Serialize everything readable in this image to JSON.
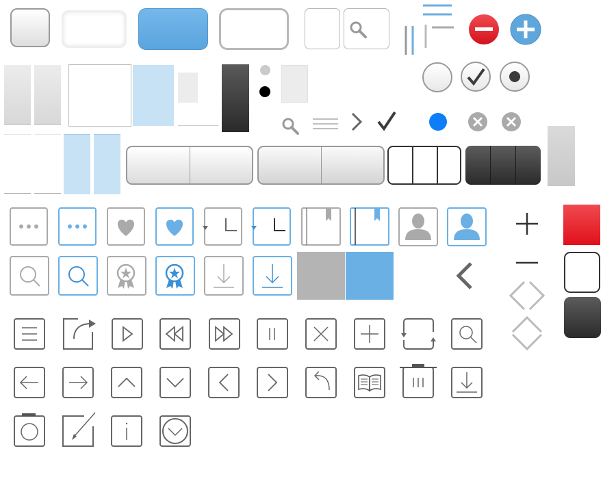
{
  "sprite_sheet": {
    "background": "#ffffff",
    "colors": {
      "accent_blue": "#6bb0e4",
      "light_blue": "#c7e2f4",
      "system_blue": "#0d7ef8",
      "red": "#e8111c",
      "dark": "#3c3c3c",
      "gray_icon": "#aaaaaa",
      "outline_icon": "#666666"
    },
    "controls": {
      "radios": [
        "empty-radio",
        "check-radio",
        "dot-radio"
      ],
      "selection_dots": [
        "gray-dot",
        "black-dot"
      ],
      "segmented_light_segments": 2,
      "segmented_outline_segments": 3,
      "segmented_dark_segments": 3
    },
    "icon_rows": {
      "tab_bar": [
        "more",
        "favorite",
        "recents",
        "bookmark",
        "contact",
        "search",
        "top-rated",
        "download"
      ],
      "toolbar_row_1": [
        "list",
        "share",
        "play",
        "rewind",
        "fast-forward",
        "pause",
        "stop",
        "add",
        "refresh",
        "search"
      ],
      "toolbar_row_2": [
        "arrow-left",
        "arrow-right",
        "chevron-up",
        "chevron-down",
        "chevron-left",
        "chevron-right",
        "reply",
        "book",
        "trash",
        "download"
      ],
      "toolbar_row_3": [
        "camera",
        "compose",
        "info",
        "clock"
      ]
    }
  }
}
